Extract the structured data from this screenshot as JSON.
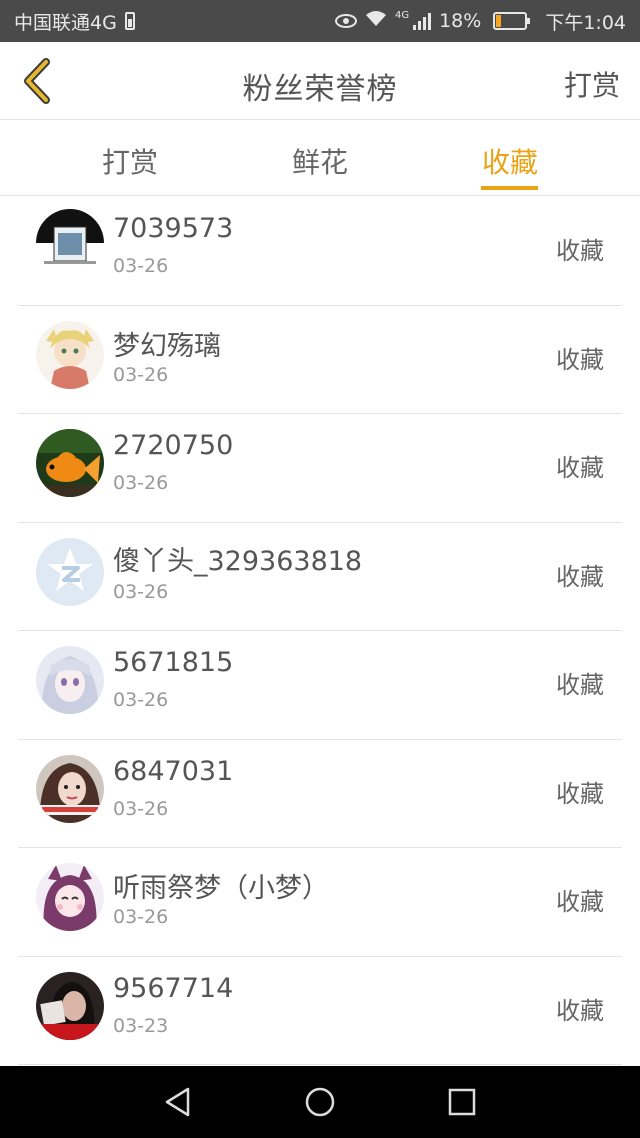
{
  "status_bar": {
    "carrier": "中国联通4G",
    "network_badge": "4G",
    "battery_percent": "18%",
    "battery_level": 0.18,
    "time": "下午1:04",
    "icons": [
      "battery-icon",
      "eye-icon",
      "wifi-icon",
      "signal-icon",
      "battery-icon"
    ]
  },
  "header": {
    "back_icon": "chevron-left-icon",
    "title": "粉丝荣誉榜",
    "action_label": "打赏"
  },
  "tabs": [
    {
      "label": "打赏",
      "active": false
    },
    {
      "label": "鲜花",
      "active": false
    },
    {
      "label": "收藏",
      "active": true
    }
  ],
  "accent_color": "#e8a317",
  "fans": [
    {
      "name": "7039573",
      "date": "03-26",
      "action": "收藏",
      "avatar": "avatar-black-badge"
    },
    {
      "name": "梦幻殇璃",
      "date": "03-26",
      "action": "收藏",
      "avatar": "avatar-anime-girl"
    },
    {
      "name": "2720750",
      "date": "03-26",
      "action": "收藏",
      "avatar": "avatar-goldfish"
    },
    {
      "name": "傻丫头_329363818",
      "date": "03-26",
      "action": "收藏",
      "avatar": "avatar-default-q"
    },
    {
      "name": "5671815",
      "date": "03-26",
      "action": "收藏",
      "avatar": "avatar-anime-pale"
    },
    {
      "name": "6847031",
      "date": "03-26",
      "action": "收藏",
      "avatar": "avatar-photo-girl"
    },
    {
      "name": "听雨祭梦（小梦）",
      "date": "03-26",
      "action": "收藏",
      "avatar": "avatar-anime-cat"
    },
    {
      "name": "9567714",
      "date": "03-23",
      "action": "收藏",
      "avatar": "avatar-photo-dark"
    }
  ],
  "nav_bar": {
    "icons": [
      "back-triangle-icon",
      "home-circle-icon",
      "recents-square-icon"
    ]
  }
}
